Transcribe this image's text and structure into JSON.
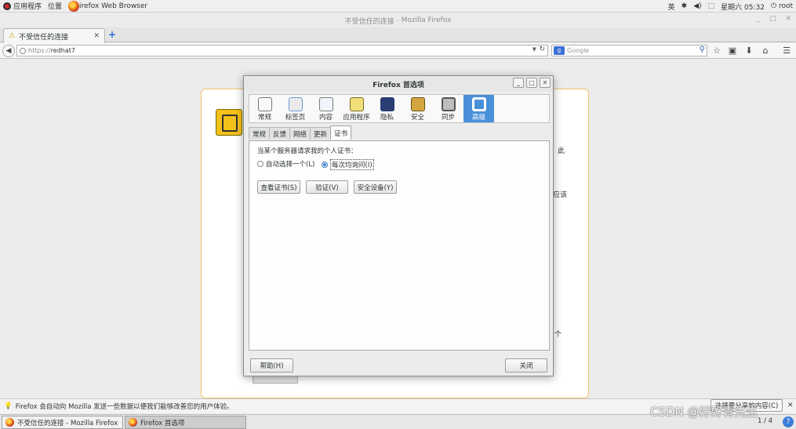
{
  "topbar": {
    "applications": "应用程序",
    "places": "位置",
    "active_app": "irefox Web Browser",
    "input_method": "英",
    "clock": "星期六 05:32",
    "user": "root"
  },
  "window": {
    "title": "不受信任的连接",
    "separator": "-",
    "app_name": "Mozilla Firefox"
  },
  "tabs": [
    {
      "title": "不受信任的连接"
    }
  ],
  "navbar": {
    "url_scheme": "https://",
    "url_host": "redhat7",
    "search_placeholder": "Google",
    "search_engine_label": "g"
  },
  "page_fragments": {
    "frag_1": "此",
    "frag_2": "应该",
    "frag_3": "个"
  },
  "notification": {
    "message": "Firefox 会自动向 Mozilla 发送一些数据以便我们能够改善您的用户体验。",
    "action_label": "选择要分享的内容(C)"
  },
  "taskbar": {
    "items": [
      {
        "label": "不受信任的连接 - Mozilla Firefox"
      },
      {
        "label": "Firefox 首选项"
      }
    ],
    "pager": "1 / 4"
  },
  "watermark": "CSDN @好好青先生",
  "prefs": {
    "title": "Firefox 首选项",
    "panes": [
      {
        "label": "常规"
      },
      {
        "label": "标签页"
      },
      {
        "label": "内容"
      },
      {
        "label": "应用程序"
      },
      {
        "label": "隐私"
      },
      {
        "label": "安全"
      },
      {
        "label": "同步"
      },
      {
        "label": "高级"
      }
    ],
    "subtabs": [
      {
        "label": "常规"
      },
      {
        "label": "反馈"
      },
      {
        "label": "网络"
      },
      {
        "label": "更新"
      },
      {
        "label": "证书"
      }
    ],
    "cert_request_label": "当某个服务器请求我的个人证书：",
    "radio_auto": "自动选择一个(L)",
    "radio_ask": "每次均询问(I)",
    "buttons": {
      "view_certs": "查看证书(S)",
      "validation": "验证(V)",
      "security_devices": "安全设备(Y)",
      "help": "帮助(H)",
      "close": "关闭"
    }
  }
}
